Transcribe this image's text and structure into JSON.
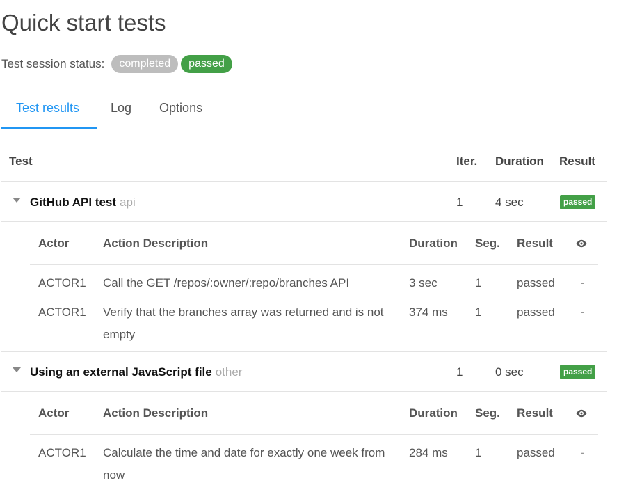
{
  "page": {
    "title": "Quick start tests"
  },
  "status": {
    "label": "Test session status:",
    "badges": [
      "completed",
      "passed"
    ]
  },
  "tabs": [
    {
      "label": "Test results",
      "active": true
    },
    {
      "label": "Log",
      "active": false
    },
    {
      "label": "Options",
      "active": false
    }
  ],
  "results": {
    "headers": {
      "test": "Test",
      "iter": "Iter.",
      "duration": "Duration",
      "result": "Result"
    },
    "action_headers": {
      "actor": "Actor",
      "description": "Action Description",
      "duration": "Duration",
      "seg": "Seg.",
      "result": "Result",
      "eye_icon": "eye-icon"
    },
    "groups": [
      {
        "name": "GitHub API test",
        "tag": "api",
        "iter": "1",
        "duration": "4 sec",
        "result": "passed",
        "actions": [
          {
            "actor": "ACTOR1",
            "description": "Call the GET /repos/:owner/:repo/branches API",
            "duration": "3 sec",
            "seg": "1",
            "result": "passed",
            "extra": "-"
          },
          {
            "actor": "ACTOR1",
            "description": "Verify that the branches array was returned and is not empty",
            "duration": "374 ms",
            "seg": "1",
            "result": "passed",
            "extra": "-"
          }
        ]
      },
      {
        "name": "Using an external JavaScript file",
        "tag": "other",
        "iter": "1",
        "duration": "0 sec",
        "result": "passed",
        "actions": [
          {
            "actor": "ACTOR1",
            "description": "Calculate the time and date for exactly one week from now",
            "duration": "284 ms",
            "seg": "1",
            "result": "passed",
            "extra": "-"
          }
        ]
      }
    ]
  },
  "colors": {
    "accent": "#2196f3",
    "success": "#43a047",
    "neutral_badge": "#bdbdbd"
  }
}
